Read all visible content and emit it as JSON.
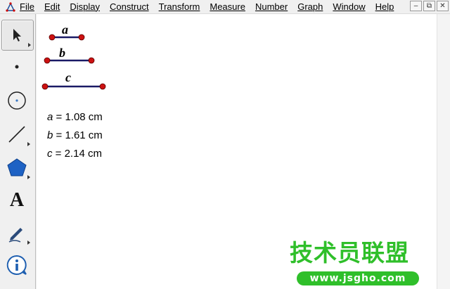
{
  "menu": {
    "items": [
      "File",
      "Edit",
      "Display",
      "Construct",
      "Transform",
      "Measure",
      "Number",
      "Graph",
      "Window",
      "Help"
    ]
  },
  "window_controls": {
    "minimize": "–",
    "restore": "⧉",
    "close": "✕"
  },
  "toolbox": {
    "tools": [
      {
        "name": "selection-arrow-tool",
        "icon": "arrow-icon",
        "active": true
      },
      {
        "name": "point-tool",
        "icon": "point-icon"
      },
      {
        "name": "compass-tool",
        "icon": "circle-icon"
      },
      {
        "name": "straightedge-tool",
        "icon": "segment-icon"
      },
      {
        "name": "polygon-tool",
        "icon": "pentagon-icon"
      },
      {
        "name": "text-tool",
        "icon": "text-A-icon",
        "glyph": "A"
      },
      {
        "name": "marker-tool",
        "icon": "pen-icon"
      },
      {
        "name": "information-tool",
        "icon": "info-icon",
        "glyph": "i"
      }
    ]
  },
  "segments": [
    {
      "label": "a"
    },
    {
      "label": "b"
    },
    {
      "label": "c"
    }
  ],
  "measurements": [
    {
      "var": "a",
      "eq": " = 1.08 cm"
    },
    {
      "var": "b",
      "eq": " = 1.61 cm"
    },
    {
      "var": "c",
      "eq": " = 2.14 cm"
    }
  ],
  "colors": {
    "segment": "#1a1a66",
    "point": "#cc1111",
    "watermark": "#2fbf2a"
  },
  "watermark": {
    "text": "技术员联盟",
    "url": "www.jsgho.com"
  }
}
